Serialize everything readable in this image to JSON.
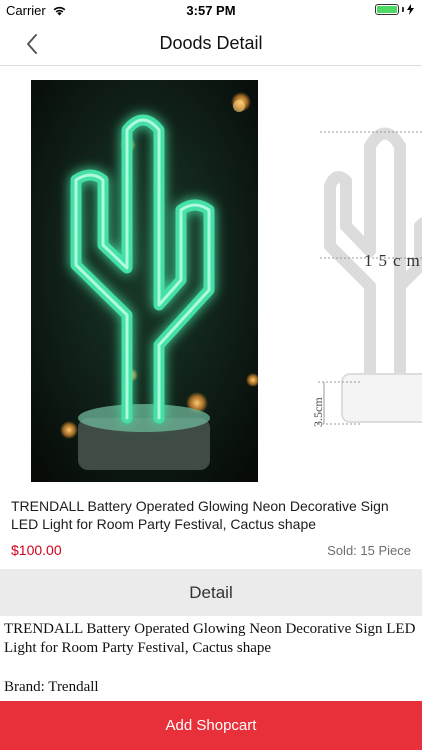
{
  "status_bar": {
    "carrier": "Carrier",
    "time": "3:57 PM"
  },
  "nav": {
    "title": "Doods Detail",
    "back_icon": "chevron-left-icon"
  },
  "gallery": {
    "images": [
      {
        "name": "neon-cactus-photo"
      },
      {
        "name": "cactus-dimension-drawing",
        "dim_width": "15cm",
        "dim_base": "3.5cm"
      }
    ]
  },
  "product": {
    "title": "TRENDALL Battery Operated Glowing Neon Decorative Sign LED Light for Room Party Festival, Cactus shape",
    "price": "$100.00",
    "sold_label": "Sold: 15 Piece"
  },
  "detail": {
    "header": "Detail",
    "description": "TRENDALL Battery Operated Glowing Neon Decorative Sign LED Light for Room Party Festival, Cactus shape",
    "brand": "Brand: Trendall"
  },
  "footer": {
    "add_label": "Add Shopcart"
  },
  "colors": {
    "accent": "#e8303a",
    "price": "#d0021b",
    "battery": "#4cd964",
    "neon": "#3dd99a"
  }
}
